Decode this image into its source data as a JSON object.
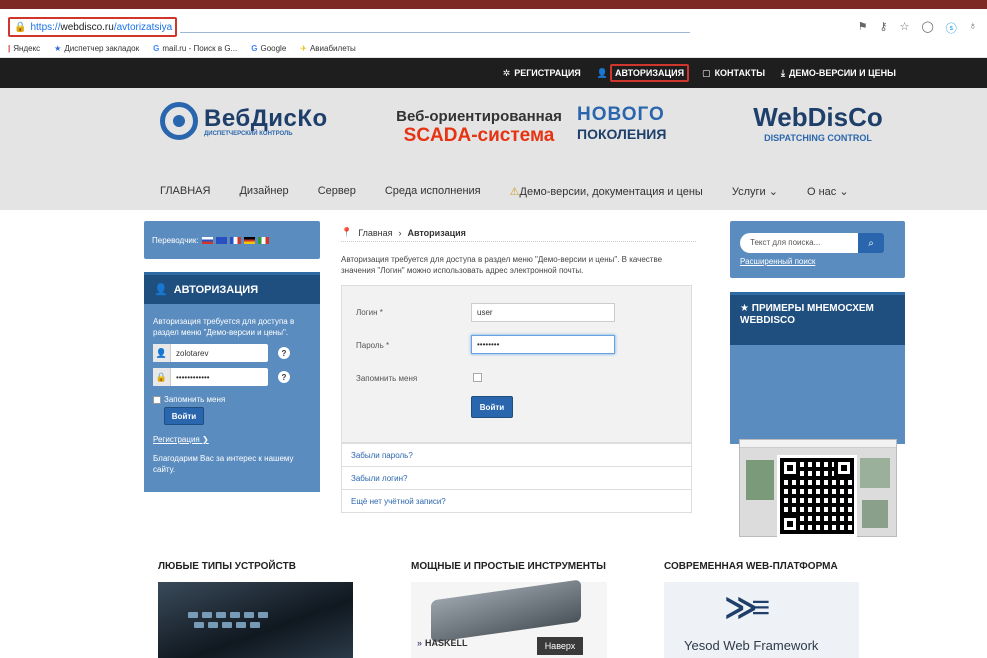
{
  "browser": {
    "url_scheme": "https://",
    "url_host": "webdisco.ru",
    "url_path": "/avtorizatsiya",
    "bookmarks": [
      {
        "icon": "yandex-icon",
        "label": "Яндекс"
      },
      {
        "icon": "star-icon",
        "label": "Диспетчер закладок"
      },
      {
        "icon": "google-g-icon",
        "label": "mail.ru - Поиск в G..."
      },
      {
        "icon": "google-g-icon",
        "label": "Google"
      },
      {
        "icon": "plane-icon",
        "label": "Авиабилеты"
      }
    ]
  },
  "topnav": {
    "register": "РЕГИСТРАЦИЯ",
    "login": "АВТОРИЗАЦИЯ",
    "contacts": "КОНТАКТЫ",
    "demo": "ДЕМО-ВЕРСИИ И ЦЕНЫ"
  },
  "hero": {
    "logo_name": "ВебДисКо",
    "logo_sub": "ДИСПЕТЧЕРСКИЙ КОНТРОЛЬ",
    "tagline_1": "Веб-ориентированная",
    "tagline_2": "SCADA-система",
    "new_1": "НОВОГО",
    "new_2": "ПОКОЛЕНИЯ",
    "logo_right": "WebDisCo",
    "logo_right_sub": "DISPATCHING CONTROL"
  },
  "menu": {
    "items": [
      "ГЛАВНАЯ",
      "Дизайнер",
      "Сервер",
      "Среда исполнения",
      "Демо-версии, документация и цены",
      "Услуги ⌄",
      "О нас ⌄"
    ]
  },
  "left": {
    "translator": "Переводчик:",
    "auth_title": "АВТОРИЗАЦИЯ",
    "auth_note": "Авторизация требуется для доступа в раздел меню \"Демо-версии и цены\".",
    "username": "zolotarev",
    "password": "••••••••••••",
    "remember": "Запомнить меня",
    "login_btn": "Войти",
    "register_link": "Регистрация",
    "thanks": "Благодарим Вас за интерес к нашему сайту."
  },
  "center": {
    "crumb_home": "Главная",
    "crumb_current": "Авторизация",
    "intro": "Авторизация требуется для доступа в раздел меню \"Демо-версии и цены\". В качестве значения \"Логин\" можно использовать адрес электронной почты.",
    "label_login": "Логин *",
    "value_login": "user",
    "label_password": "Пароль *",
    "value_password": "••••••••",
    "label_remember": "Запомнить меня",
    "submit": "Войти",
    "links": [
      "Забыли пароль?",
      "Забыли логин?",
      "Ещё нет учётной записи?"
    ]
  },
  "right": {
    "search_placeholder": "Текст для поиска...",
    "advanced_search": "Расширенный поиск",
    "examples_title": "ПРИМЕРЫ МНЕМОСХЕМ WEBDISCO"
  },
  "features": {
    "f1_title": "ЛЮБЫЕ ТИПЫ УСТРОЙСТВ",
    "f2_title": "МОЩНЫЕ И ПРОСТЫЕ ИНСТРУМЕНТЫ",
    "f3_title": "СОВРЕМЕННАЯ WEB-ПЛАТФОРМА",
    "haskell": "HASKELL",
    "naverh": "Наверх",
    "yesod": "Yesod Web Framework"
  },
  "colors": {
    "accent_blue": "#2a66ad",
    "panel_blue": "#5a8cbf",
    "dark_nav": "#1e1e1e",
    "highlight_red": "#d0362c",
    "brand_red": "#e63312"
  }
}
